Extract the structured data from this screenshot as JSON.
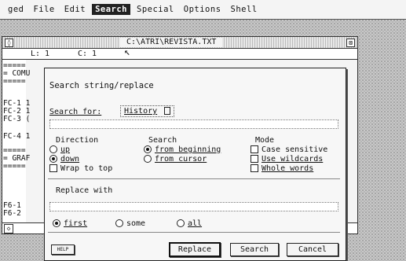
{
  "menubar": {
    "items": [
      "ged",
      "File",
      "Edit",
      "Search",
      "Special",
      "Options",
      "Shell"
    ],
    "active": "Search"
  },
  "window": {
    "title": "C:\\ATRI\\REVISTA.TXT",
    "close_glyph": "◊",
    "full_glyph": "⊠",
    "status": {
      "line": "L: 1",
      "column": "C: 1"
    },
    "text_lines": [
      "=====",
      "= COMU",
      "=====",
      "FC-1 1",
      "FC-2 1",
      "FC-3 (",
      "FC-4 1",
      "=====",
      "= GRAF",
      "=====",
      "F6-1",
      "F6-2"
    ],
    "left_arrow": "◇"
  },
  "dialog": {
    "title": "Search string/replace",
    "search_for_label": "Search for:",
    "history_button": "History",
    "search_for_value": "",
    "direction": {
      "heading": "Direction",
      "options": [
        "up",
        "down",
        "Wrap to top"
      ],
      "selected": "down"
    },
    "search": {
      "heading": "Search",
      "options": [
        "from beginning",
        "from cursor"
      ],
      "selected": "from beginning"
    },
    "mode": {
      "heading": "Mode",
      "options": [
        "Case sensitive",
        "Use wildcards",
        "Whole words"
      ]
    },
    "replace_label": "Replace with",
    "replace_value": "",
    "count": {
      "options": [
        "first",
        "some",
        "all"
      ],
      "selected": "first"
    },
    "help_button": "HELP",
    "buttons": {
      "replace": "Replace",
      "search": "Search",
      "cancel": "Cancel"
    }
  }
}
